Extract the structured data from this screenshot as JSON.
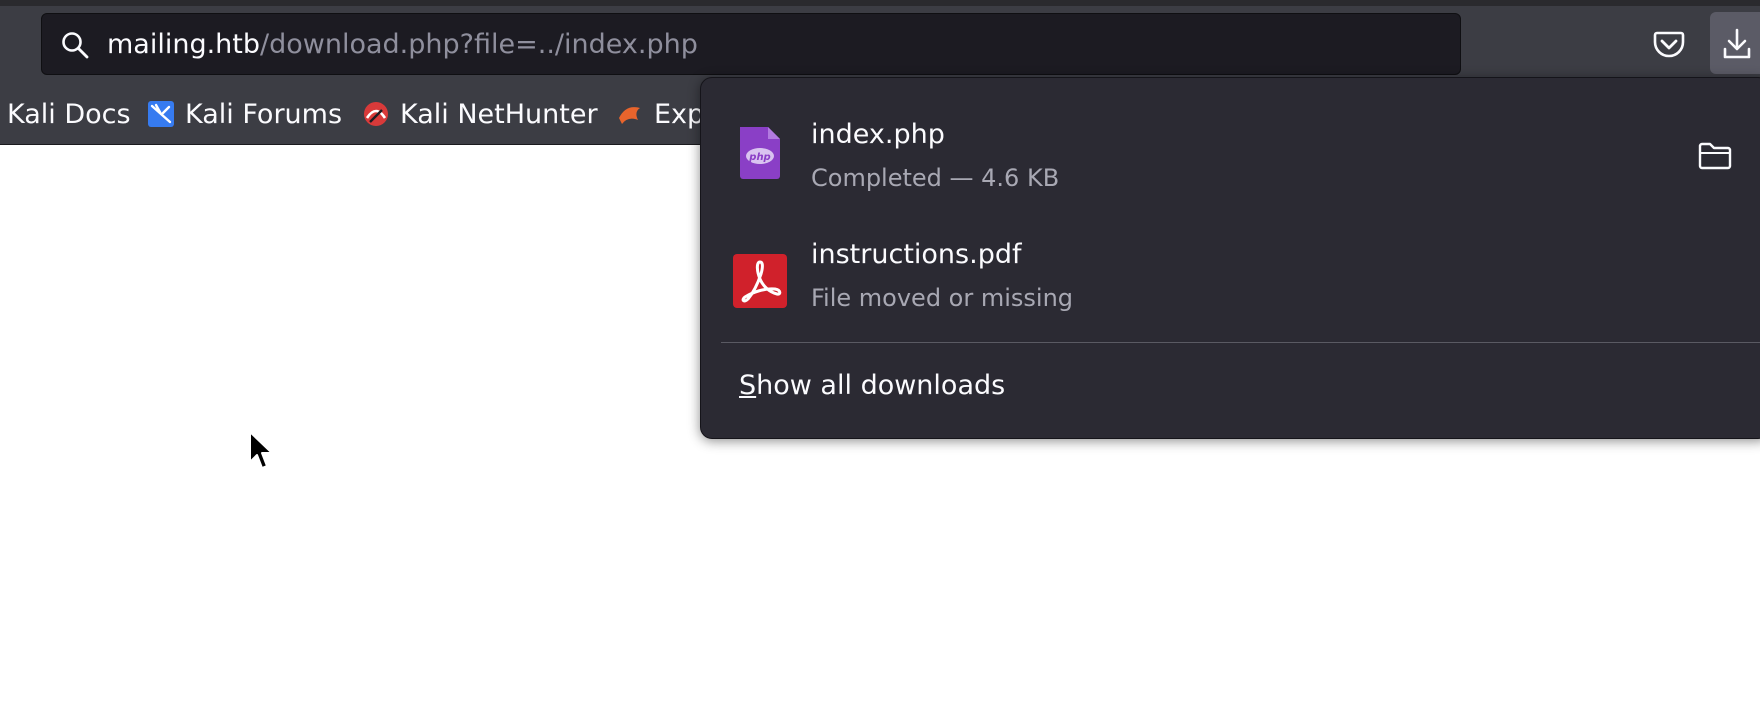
{
  "urlbar": {
    "domain": "mailing.htb",
    "path": "/download.php?file=../index.php"
  },
  "toolbar": {
    "icons": [
      "search-icon",
      "pocket-icon",
      "download-arrow-icon"
    ]
  },
  "bookmarks": [
    {
      "label": "Kali Docs",
      "icon": null
    },
    {
      "label": "Kali Forums",
      "icon": "kali-dragon-icon"
    },
    {
      "label": "Kali NetHunter",
      "icon": "nethunter-icon"
    },
    {
      "label": "Exp",
      "icon": "exploitdb-icon"
    }
  ],
  "downloads": {
    "items": [
      {
        "name": "index.php",
        "status": "Completed — 4.6 KB",
        "icon": "php-file-icon"
      },
      {
        "name": "instructions.pdf",
        "status": "File moved or missing",
        "icon": "pdf-file-icon"
      }
    ],
    "show_all_accesskey": "S",
    "show_all_rest": "how all downloads"
  },
  "colors": {
    "toolbar_bg": "#3c3d44",
    "urlbar_bg": "#1c1b22",
    "panel_bg": "#2b2a33",
    "php_purple": "#8a3fc6",
    "pdf_red": "#d0212b"
  }
}
